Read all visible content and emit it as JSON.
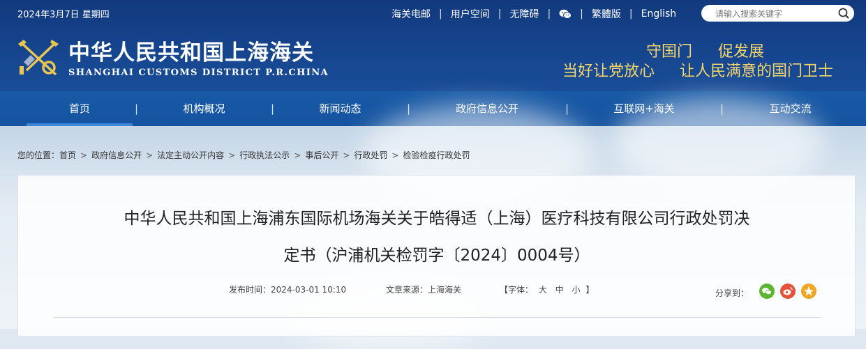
{
  "header": {
    "date": "2024年3月7日 星期四",
    "top_links": [
      "海关电邮",
      "用户空间",
      "无障碍",
      "繁體版",
      "English"
    ],
    "search_placeholder": "请输入搜索关键字",
    "site_name_cn": "中华人民共和国上海海关",
    "site_name_en": "SHANGHAI CUSTOMS DISTRICT P.R.CHINA",
    "slogan_line1": [
      "守国门",
      "促发展"
    ],
    "slogan_line2": [
      "当好让党放心",
      "让人民满意的国门卫士"
    ]
  },
  "nav": {
    "items": [
      "首页",
      "机构概况",
      "新闻动态",
      "政府信息公开",
      "互联网+海关",
      "互动交流"
    ],
    "separator": "|",
    "active": "首页"
  },
  "breadcrumb": {
    "prefix": "您的位置：",
    "items": [
      "首页",
      "政府信息公开",
      "法定主动公开内容",
      "行政执法公示",
      "事后公开",
      "行政处罚",
      "检验检疫行政处罚"
    ],
    "separator": ">"
  },
  "article": {
    "title_line1": "中华人民共和国上海浦东国际机场海关关于皓得适（上海）医疗科技有限公司行政处罚决",
    "title_line2": "定书（沪浦机关检罚字〔2024〕0004号）",
    "publish_time": "发布时间：2024-03-01 10:10",
    "source": "文章来源：上海海关",
    "font_size_open": "【字体：",
    "font_sizes": [
      "大",
      "中",
      "小"
    ],
    "font_size_close": "】",
    "share_label": "分享到："
  },
  "colors": {
    "header_bg": "#16468f",
    "nav_bg": "#1657a3",
    "slogan": "#f5d56a",
    "wechat": "#5cb531",
    "weibo": "#e2533a",
    "favorite": "#f0a424"
  },
  "icons": {
    "search": "search-icon",
    "wechat": "wechat-icon",
    "logo": "customs-emblem",
    "share": [
      "wechat-share-icon",
      "weibo-share-icon",
      "favorite-share-icon"
    ]
  }
}
